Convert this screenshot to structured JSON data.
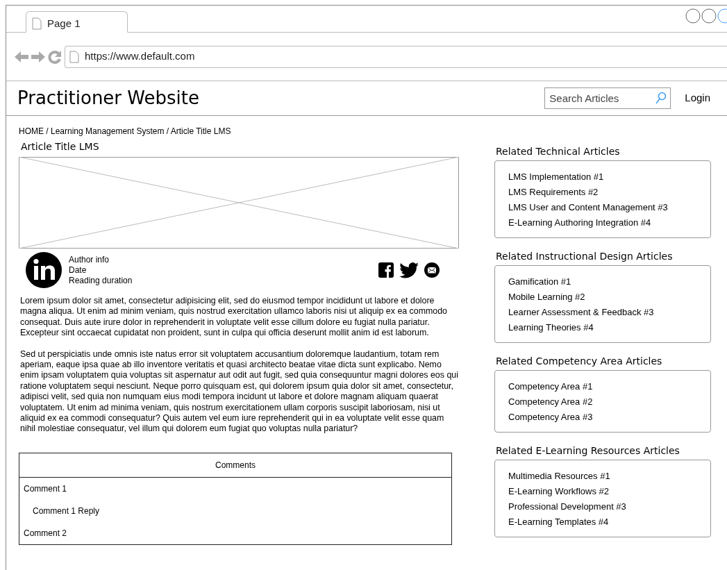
{
  "browser": {
    "tab": {
      "label": "Page 1",
      "selected": true
    },
    "url": "https://www.default.com"
  },
  "header": {
    "site_title": "Practitioner Website",
    "search": {
      "placeholder": "Search Articles"
    },
    "login": "Login"
  },
  "breadcrumb": "HOME / Learning Management System / Article Title LMS",
  "article": {
    "title": "Article Title LMS",
    "author": [
      "Author info",
      "Date",
      "Reading duration"
    ],
    "paragraphs": [
      "Lorem ipsum dolor sit amet, consectetur adipisicing elit, sed do eiusmod tempor incididunt ut labore et dolore magna aliqua. Ut enim ad minim veniam, quis nostrud exercitation ullamco laboris nisi ut aliquip ex ea commodo consequat. Duis aute irure dolor in reprehenderit in voluptate velit esse cillum dolore eu fugiat nulla pariatur. Excepteur sint occaecat cupidatat non proident, sunt in culpa qui officia deserunt mollit anim id est laborum.",
      "Sed ut perspiciatis unde omnis iste natus error sit voluptatem accusantium doloremque laudantium, totam rem aperiam, eaque ipsa quae ab illo inventore veritatis et quasi architecto beatae vitae dicta sunt explicabo. Nemo enim ipsam voluptatem quia voluptas sit aspernatur aut odit aut fugit, sed quia consequuntur magni dolores eos qui ratione voluptatem sequi nesciunt. Neque porro quisquam est, qui dolorem ipsum quia dolor sit amet, consectetur, adipisci velit, sed quia non numquam eius modi tempora incidunt ut labore et dolore magnam aliquam quaerat voluptatem. Ut enim ad minima veniam, quis nostrum exercitationem ullam corporis suscipit laboriosam, nisi ut aliquid ex ea commodi consequatur? Quis autem vel eum iure reprehenderit qui in ea voluptate velit esse quam nihil molestiae consequatur, vel illum qui dolorem eum fugiat quo voluptas nulla pariatur?"
    ]
  },
  "comments": {
    "title": "Comments",
    "items": [
      {
        "text": "Comment 1",
        "children": [
          {
            "text": "Comment 1 Reply"
          }
        ]
      },
      {
        "text": "Comment 2"
      }
    ]
  },
  "related": [
    {
      "title": "Related Technical Articles",
      "items": [
        "LMS Implementation #1",
        "LMS Requirements #2",
        "LMS User and Content Management #3",
        "E-Learning Authoring Integration #4"
      ]
    },
    {
      "title": "Related Instructional Design Articles",
      "items": [
        "Gamification #1",
        "Mobile Learning #2",
        "Learner Assessment & Feedback #3",
        "Learning Theories #4"
      ]
    },
    {
      "title": "Related Competency Area Articles",
      "items": [
        "Competency Area #1",
        "Competency Area #2",
        "Competency Area #3"
      ]
    },
    {
      "title": "Related E-Learning Resources Articles",
      "items": [
        "Multimedia Resources #1",
        "E-Learning Workflows #2",
        "Professional Development #3",
        "E-Learning Templates #4"
      ]
    }
  ]
}
